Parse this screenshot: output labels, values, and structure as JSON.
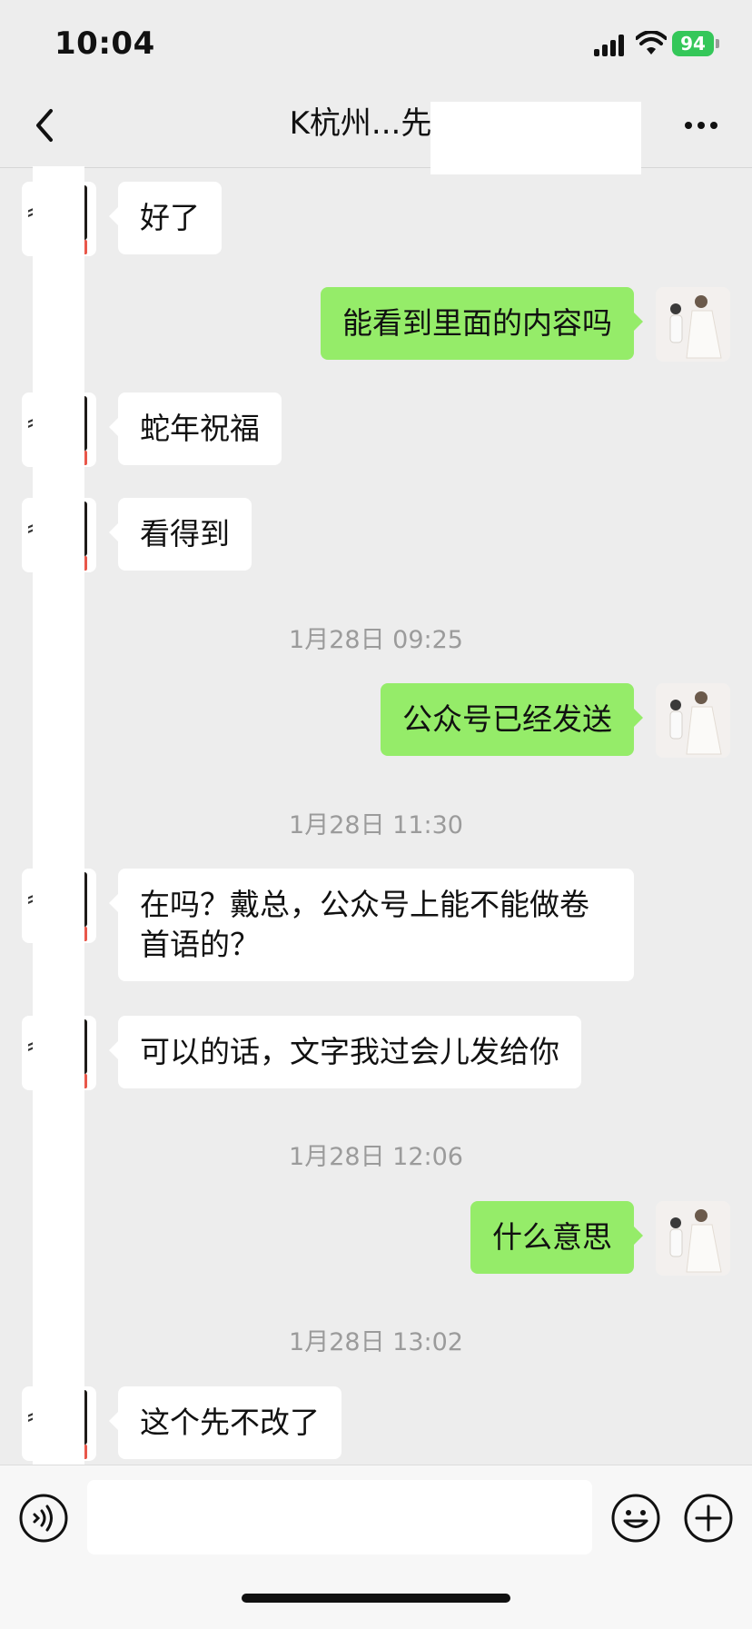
{
  "status_bar": {
    "time": "10:04",
    "battery": "94"
  },
  "header": {
    "title": "K杭州...先生"
  },
  "messages": [
    {
      "side": "in",
      "text": "好了"
    },
    {
      "side": "out",
      "text": "能看到里面的内容吗"
    },
    {
      "side": "in",
      "text": "蛇年祝福"
    },
    {
      "side": "in",
      "text": "看得到"
    },
    {
      "type": "time",
      "text": "1月28日 09:25"
    },
    {
      "side": "out",
      "text": "公众号已经发送"
    },
    {
      "type": "time",
      "text": "1月28日 11:30"
    },
    {
      "side": "in",
      "text": "在吗？戴总，公众号上能不能做卷首语的？"
    },
    {
      "side": "in",
      "text": "可以的话，文字我过会儿发给你"
    },
    {
      "type": "time",
      "text": "1月28日 12:06"
    },
    {
      "side": "out",
      "text": "什么意思"
    },
    {
      "type": "time",
      "text": "1月28日 13:02"
    },
    {
      "side": "in",
      "text": "这个先不改了"
    }
  ],
  "input": {
    "value": ""
  },
  "colors": {
    "background": "#ededed",
    "outgoing_bubble": "#95ec69",
    "incoming_bubble": "#ffffff",
    "timestamp": "#9b9b9b",
    "battery": "#34c759"
  },
  "icons": {
    "back": "chevron-left-icon",
    "more": "ellipsis-icon",
    "voice": "voice-icon",
    "emoji": "emoji-icon",
    "plus": "plus-icon"
  }
}
